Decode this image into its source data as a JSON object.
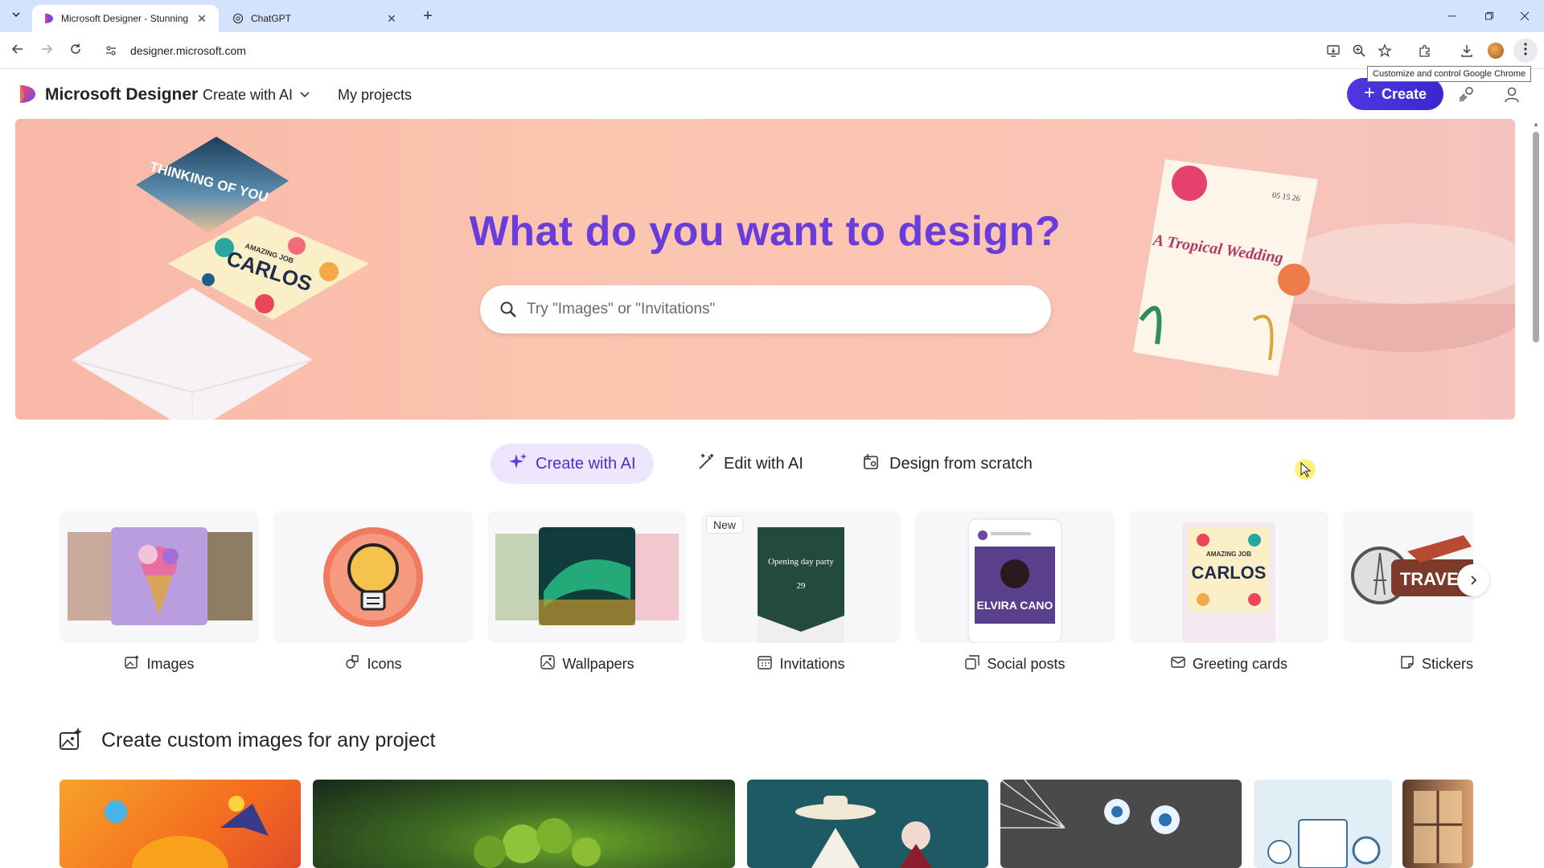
{
  "browser": {
    "tabs": [
      {
        "title": "Microsoft Designer - Stunning",
        "active": true,
        "icon": "designer-logo-icon"
      },
      {
        "title": "ChatGPT",
        "active": false,
        "icon": "chatgpt-icon"
      }
    ],
    "url": "designer.microsoft.com",
    "tooltip": "Customize and control Google Chrome"
  },
  "header": {
    "brand": "Microsoft Designer",
    "nav_dropdown": "Create with AI",
    "nav_link": "My projects",
    "create_label": "Create"
  },
  "hero": {
    "title": "What do you want to design?",
    "search_placeholder": "Try \"Images\" or \"Invitations\""
  },
  "modes": [
    {
      "label": "Create with AI",
      "active": true,
      "icon": "sparkle-icon"
    },
    {
      "label": "Edit with AI",
      "active": false,
      "icon": "magic-wand-icon"
    },
    {
      "label": "Design from scratch",
      "active": false,
      "icon": "canvas-icon"
    }
  ],
  "categories": [
    {
      "label": "Images",
      "icon": "image-sparkle-icon"
    },
    {
      "label": "Icons",
      "icon": "shapes-icon"
    },
    {
      "label": "Wallpapers",
      "icon": "wallpaper-icon"
    },
    {
      "label": "Invitations",
      "icon": "calendar-icon",
      "badge": "New"
    },
    {
      "label": "Social posts",
      "icon": "social-icon"
    },
    {
      "label": "Greeting cards",
      "icon": "mail-icon"
    },
    {
      "label": "Stickers",
      "icon": "sticker-icon"
    }
  ],
  "thumb_text": {
    "invite": "Opening day party",
    "invite_date": "29",
    "social_name": "ELVIRA CANO",
    "greeting_top": "AMAZING JOB",
    "greeting_name": "CARLOS",
    "sticker": "TRAVEL",
    "card_thinking": "THINKING OF YOU",
    "card_carlos_top": "AMAZING JOB",
    "card_carlos_name": "CARLOS",
    "wedding": "A Tropical Wedding",
    "wedding_date": "05 15 26"
  },
  "section": {
    "title": "Create custom images for any project"
  },
  "colors": {
    "accent": "#4f37e0",
    "hero_title": "#6a3ddb",
    "active_mode_bg": "#ede6fd"
  }
}
